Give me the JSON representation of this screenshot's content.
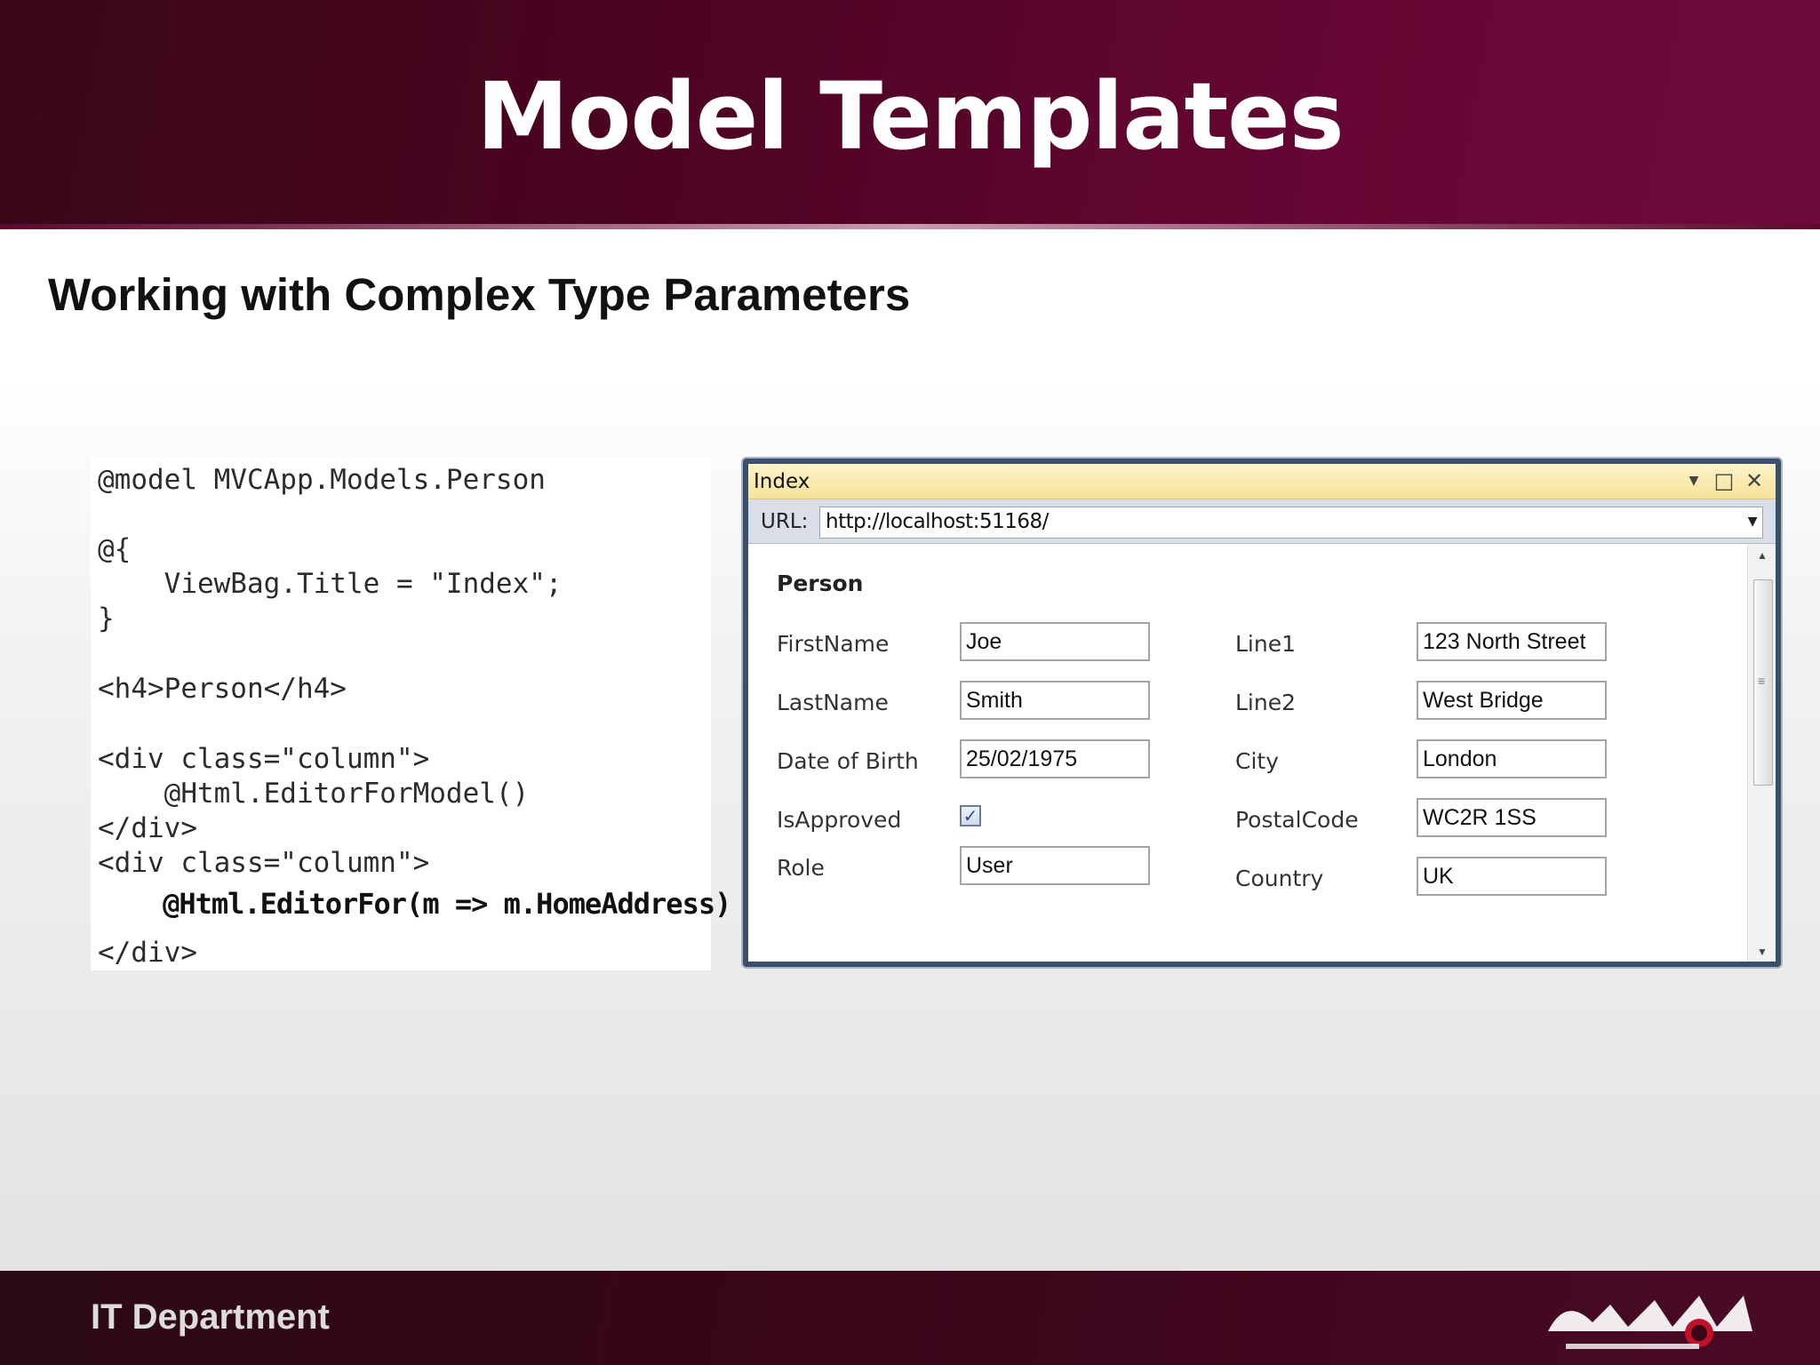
{
  "slide": {
    "title": "Model Templates",
    "subtitle": "Working with Complex Type Parameters"
  },
  "code": {
    "lines": [
      "@model MVCApp.Models.Person",
      "@{",
      "    ViewBag.Title = \"Index\";",
      "}",
      "<h4>Person</h4>",
      "<div class=\"column\">",
      "    @Html.EditorForModel()",
      "</div>",
      "<div class=\"column\">",
      "    @Html.EditorFor(m => m.HomeAddress)",
      "</div>"
    ]
  },
  "browser": {
    "tab_title": "Index",
    "url_label": "URL:",
    "url": "http://localhost:51168/",
    "heading": "Person",
    "person_fields": [
      {
        "label": "FirstName",
        "value": "Joe"
      },
      {
        "label": "LastName",
        "value": "Smith"
      },
      {
        "label": "Date of Birth",
        "value": "25/02/1975"
      },
      {
        "label": "IsApproved",
        "checked": true
      },
      {
        "label": "Role",
        "value": "User"
      }
    ],
    "address_fields": [
      {
        "label": "Line1",
        "value": "123 North Street"
      },
      {
        "label": "Line2",
        "value": "West Bridge"
      },
      {
        "label": "City",
        "value": "London"
      },
      {
        "label": "PostalCode",
        "value": "WC2R 1SS"
      },
      {
        "label": "Country",
        "value": "UK"
      }
    ],
    "checkbox_mark": "✓",
    "window_icons": {
      "dropdown": "▼",
      "maximize": "□",
      "close": "✕"
    }
  },
  "footer": {
    "department": "IT Department"
  },
  "colors": {
    "header": "#4b0420",
    "window_border": "#3b4f6b",
    "titlebar": "#f6e39a"
  }
}
